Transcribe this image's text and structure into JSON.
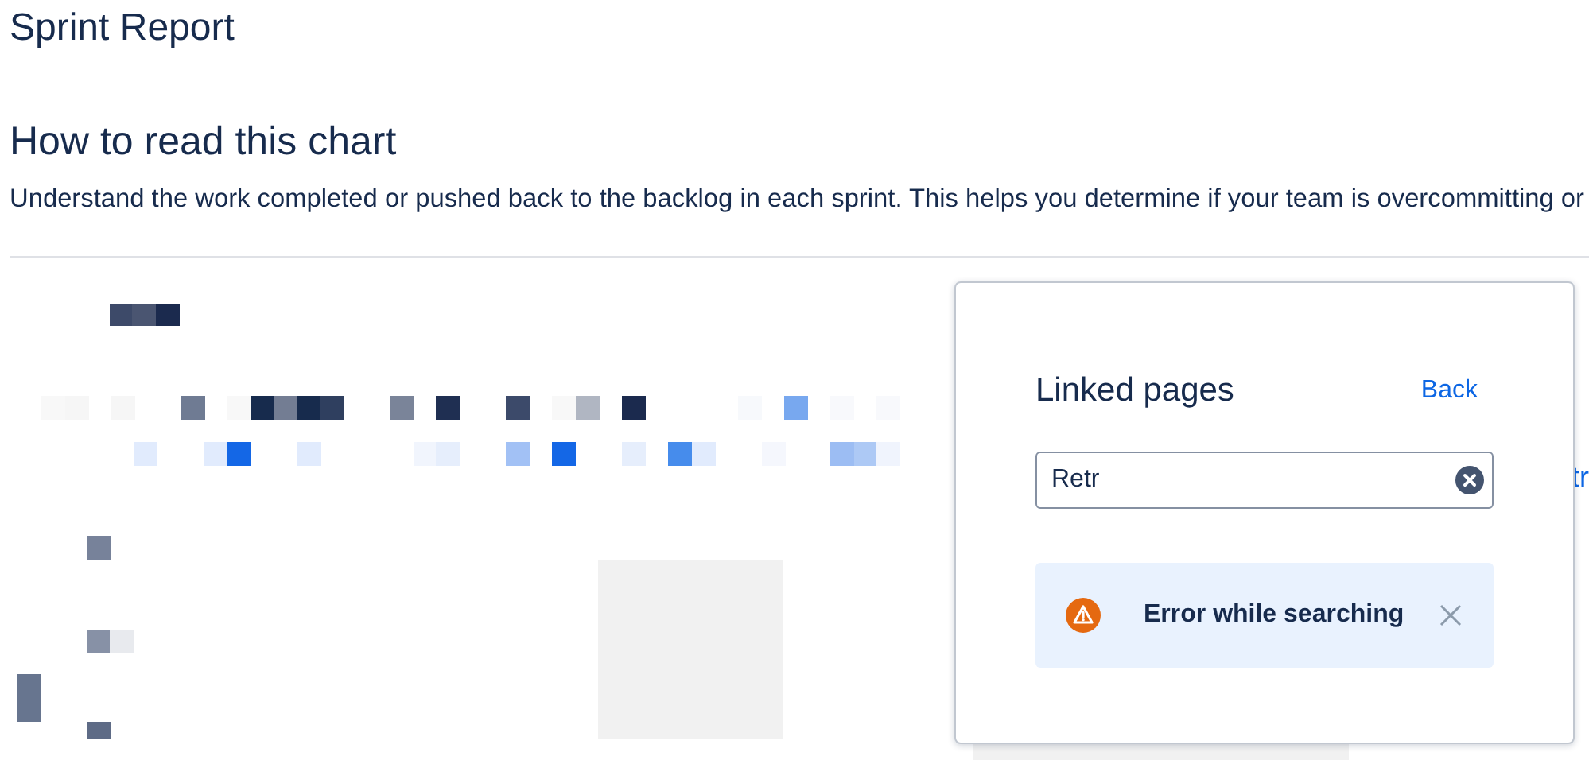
{
  "page": {
    "title": "Sprint Report"
  },
  "section": {
    "heading": "How to read this chart",
    "description": "Understand the work completed or pushed back to the backlog in each sprint. This helps you determine if your team is overcommitting or"
  },
  "edge_link": {
    "label": "tr"
  },
  "linked_pages_popup": {
    "title": "Linked pages",
    "back_label": "Back",
    "search": {
      "value": "Retr"
    },
    "alert": {
      "message": "Error while searching"
    }
  }
}
